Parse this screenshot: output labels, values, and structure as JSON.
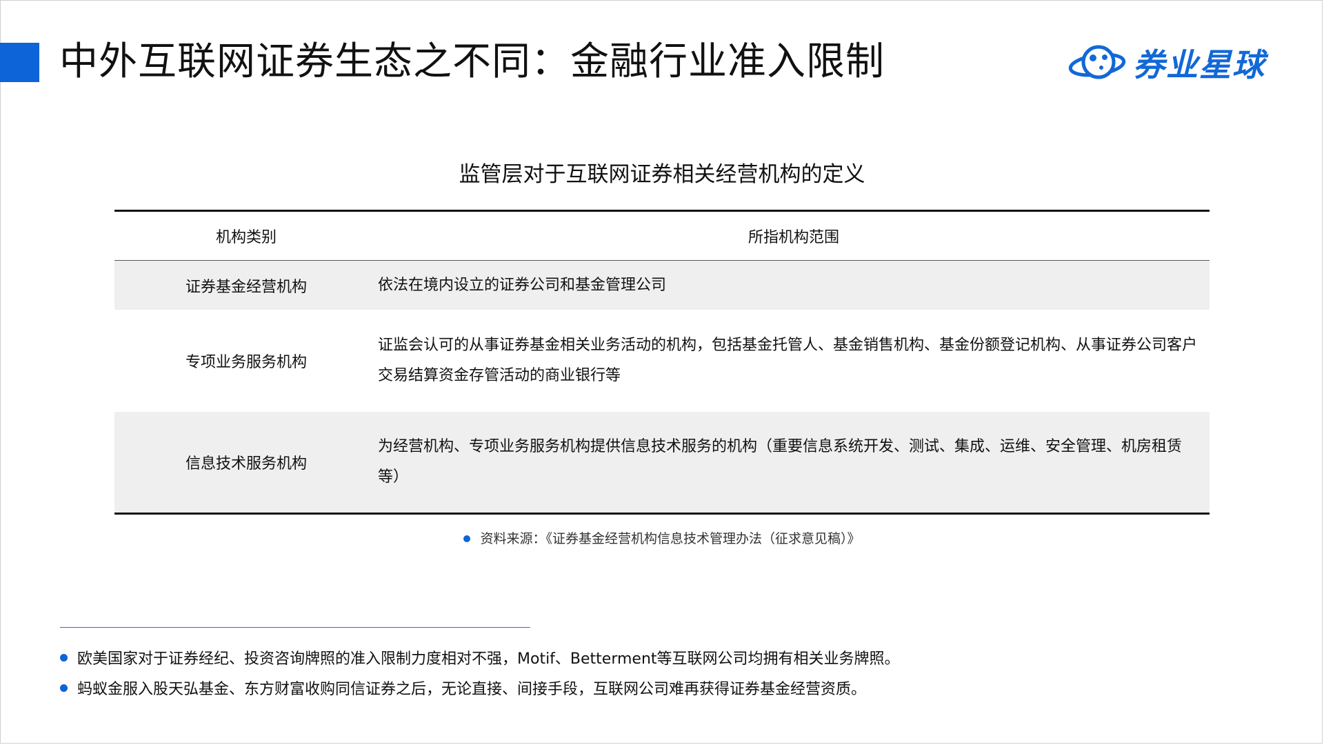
{
  "slide": {
    "title": "中外互联网证券生态之不同：金融行业准入限制",
    "brand_name": "券业星球"
  },
  "table": {
    "caption": "监管层对于互联网证券相关经营机构的定义",
    "headers": [
      "机构类别",
      "所指机构范围"
    ],
    "rows": [
      {
        "category": "证券基金经营机构",
        "scope": "依法在境内设立的证券公司和基金管理公司"
      },
      {
        "category": "专项业务服务机构",
        "scope": "证监会认可的从事证券基金相关业务活动的机构，包括基金托管人、基金销售机构、基金份额登记机构、从事证券公司客户交易结算资金存管活动的商业银行等"
      },
      {
        "category": "信息技术服务机构",
        "scope": "为经营机构、专项业务服务机构提供信息技术服务的机构（重要信息系统开发、测试、集成、运维、安全管理、机房租赁等）"
      }
    ]
  },
  "source": "资料来源：《证券基金经营机构信息技术管理办法（征求意见稿）》",
  "notes": [
    "欧美国家对于证券经纪、投资咨询牌照的准入限制力度相对不强，Motif、Betterment等互联网公司均拥有相关业务牌照。",
    "蚂蚁金服入股天弘基金、东方财富收购同信证券之后，无论直接、间接手段，互联网公司难再获得证券基金经营资质。"
  ],
  "colors": {
    "accent": "#0d63d8",
    "brand": "#1268d6",
    "row_shade": "#efefef"
  }
}
